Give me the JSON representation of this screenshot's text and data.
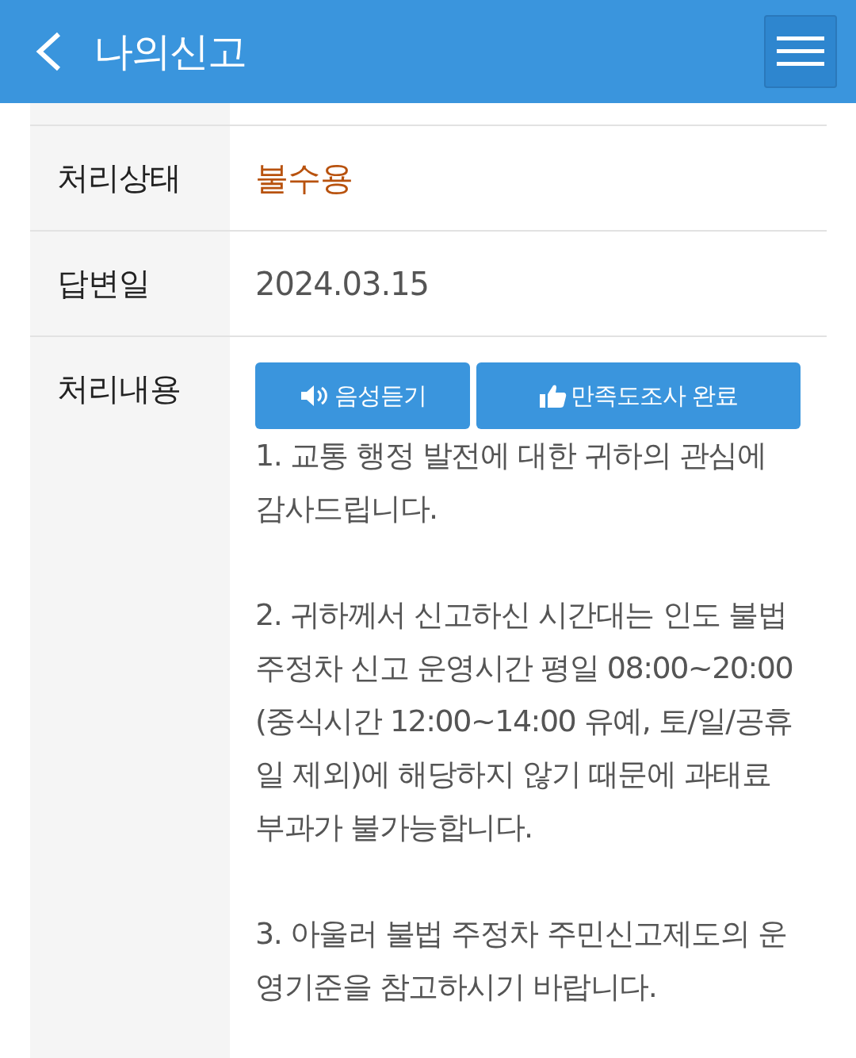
{
  "header": {
    "title": "나의신고"
  },
  "rows": [
    {
      "kind": "status",
      "label": "처리상태",
      "value": "불수용"
    },
    {
      "kind": "text",
      "label": "답변일",
      "value": "2024.03.15"
    },
    {
      "kind": "content",
      "label": "처리내용",
      "buttons": [
        {
          "kind": "speaker",
          "label": "음성듣기"
        },
        {
          "kind": "thumb",
          "label": "만족도조사 완료"
        }
      ],
      "paragraphs": [
        "1. 교통 행정 발전에 대한 귀하의 관심에 감사드립니다.",
        "2. 귀하께서 신고하신 시간대는 인도 불법 주정차 신고 운영시간 평일 08:00~20:00(중식시간 12:00~14:00 유예, 토/일/공휴일 제외)에 해당하지 않기 때문에 과태료 부과가 불가능합니다.",
        "3. 아울러 불법 주정차 주민신고제도의 운영기준을 참고하시기 바랍니다."
      ]
    }
  ]
}
